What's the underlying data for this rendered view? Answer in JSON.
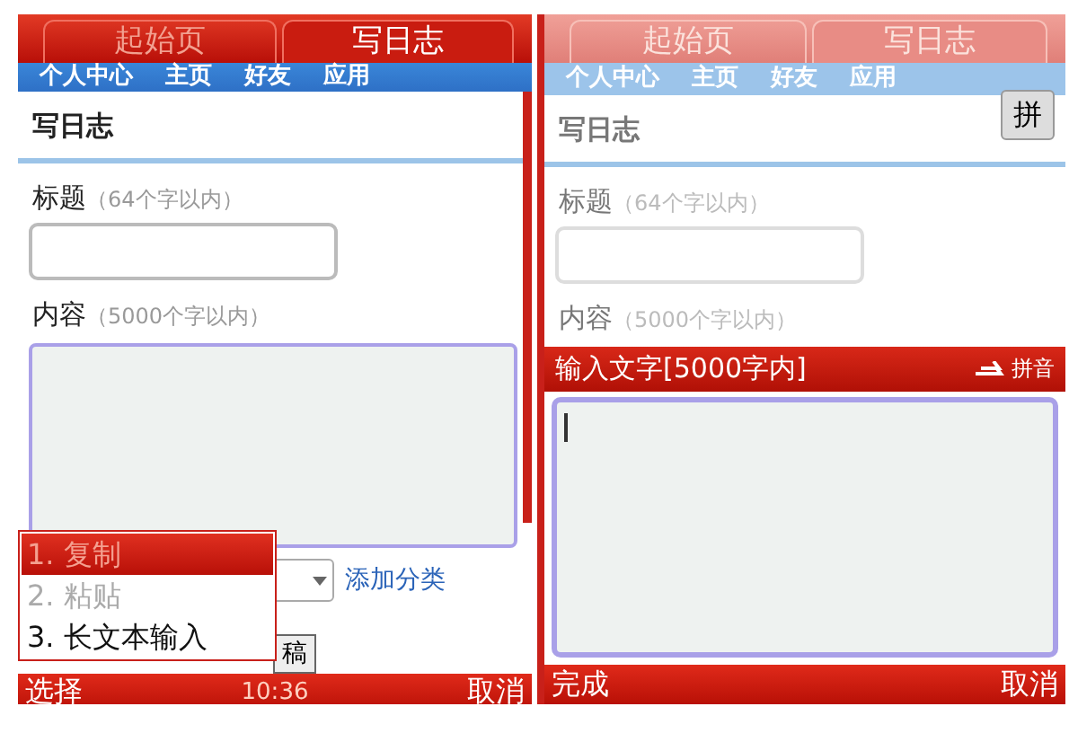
{
  "screens": [
    {
      "dimmed": false,
      "tabs": [
        {
          "label": "起始页",
          "selected": false
        },
        {
          "label": "写日志",
          "selected": true
        }
      ],
      "nav": [
        "个人中心",
        "主页",
        "好友",
        "应用"
      ],
      "heading": "写日志",
      "title_label": "标题",
      "title_hint": "（64个字以内）",
      "content_label": "内容",
      "content_hint": "（5000个字以内）",
      "add_category": "添加分类",
      "submit_button": "稿",
      "menu": [
        {
          "label": "1. 复制",
          "selected": true,
          "disabled": false
        },
        {
          "label": "2. 粘贴",
          "selected": false,
          "disabled": true
        },
        {
          "label": "3. 长文本输入",
          "selected": false,
          "disabled": false
        }
      ],
      "softkeys": {
        "left": "选择",
        "center": "10:36",
        "right": "取消"
      }
    },
    {
      "dimmed": true,
      "tabs": [
        {
          "label": "起始页",
          "selected": false
        },
        {
          "label": "写日志",
          "selected": true
        }
      ],
      "nav": [
        "个人中心",
        "主页",
        "好友",
        "应用"
      ],
      "ime_key": "拼",
      "heading": "写日志",
      "title_label": "标题",
      "title_hint": "（64个字以内）",
      "content_label": "内容",
      "content_hint": "（5000个字以内）",
      "input_panel": {
        "title": "输入文字[5000字内]",
        "ime_mode": "拼音"
      },
      "softkeys": {
        "left": "完成",
        "right": "取消"
      }
    }
  ]
}
